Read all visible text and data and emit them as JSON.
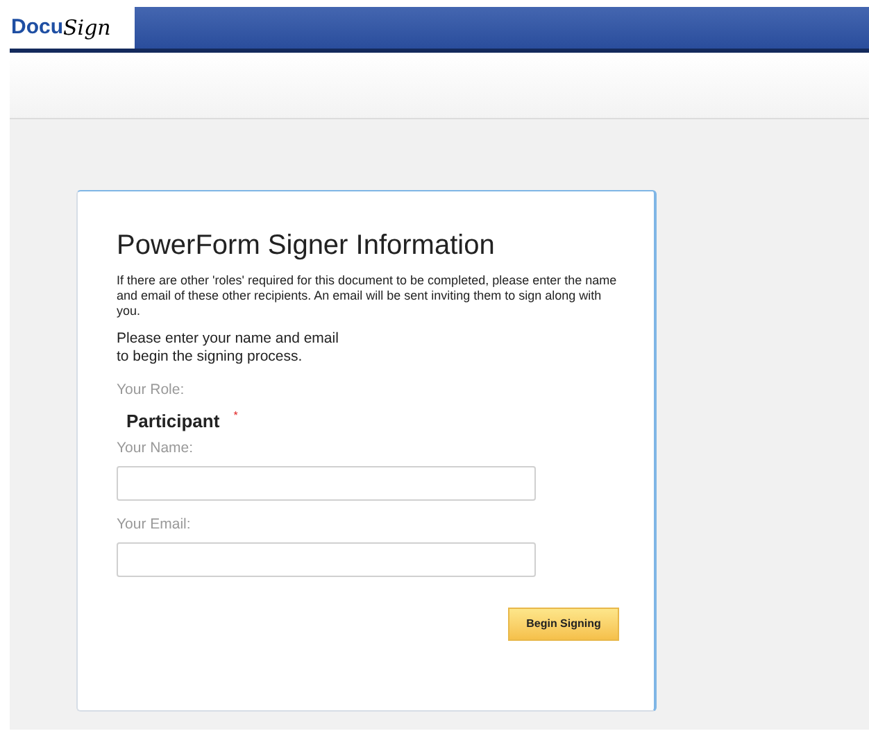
{
  "header": {
    "logo": {
      "part_1": "Docu",
      "part_2": "Sign"
    }
  },
  "form": {
    "title": "PowerForm Signer Information",
    "note": "If there are other 'roles' required for this document to be completed, please enter the name and email of these other recipients. An email will be sent inviting them to sign along with you.",
    "instruction_lines": [
      "Please enter your name and email",
      "to begin the signing process."
    ],
    "role_label": "Your Role:",
    "role": "Participant",
    "required_mark": "*",
    "fields": [
      {
        "label": "Your Name:"
      },
      {
        "label": "Your Email:"
      }
    ],
    "button": "Begin Signing"
  }
}
